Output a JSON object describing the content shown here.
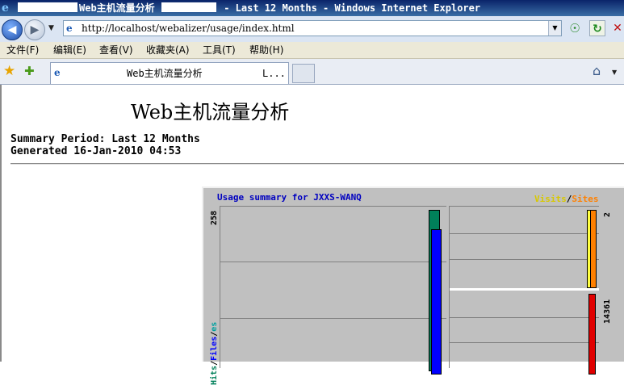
{
  "window": {
    "title_main": "Web主机流量分析",
    "title_suffix": " - Last 12 Months - Windows Internet Explorer"
  },
  "address": {
    "url": "http://localhost/webalizer/usage/index.html"
  },
  "menu": {
    "items": [
      "文件(F)",
      "编辑(E)",
      "查看(V)",
      "收藏夹(A)",
      "工具(T)",
      "帮助(H)"
    ]
  },
  "tabs": {
    "active_title": "Web主机流量分析",
    "active_title_more": "L..."
  },
  "page": {
    "heading": "Web主机流量分析",
    "summary_period": "Summary Period: Last 12 Months",
    "generated": "Generated 16-Jan-2010 04:53"
  },
  "graph": {
    "title": "Usage summary for JXXS-WANQ",
    "legend": {
      "visits": "Visits",
      "slash": "/",
      "sites": "Sites"
    },
    "left_axis": {
      "max_label": "258",
      "series_labels": [
        "Hits",
        "/",
        "Files",
        "/",
        "es"
      ]
    },
    "right_axis": {
      "top_label": "2",
      "bottom_label": "14361"
    },
    "colors": {
      "hits": "#00805a",
      "files": "#0000ff",
      "visits": "#ffff40",
      "sites": "#ff8000",
      "kbytes": "#e00000",
      "title": "#0000c0"
    },
    "values": {
      "hits": 258,
      "visits": 2,
      "kbytes": 14361
    }
  }
}
